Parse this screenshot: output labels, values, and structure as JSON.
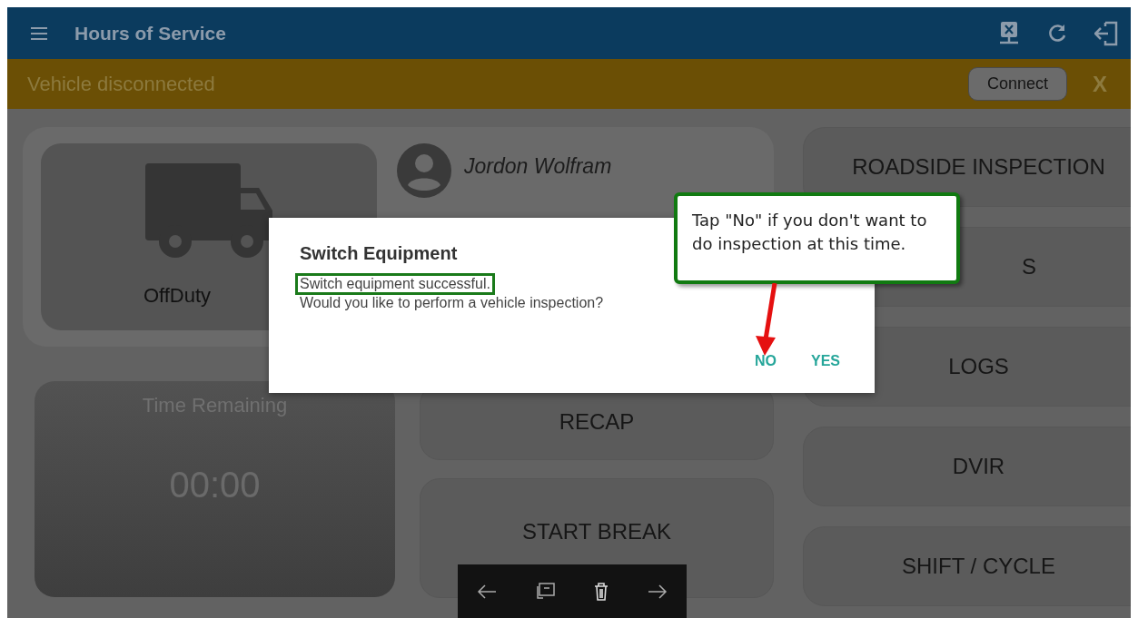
{
  "app_bar": {
    "title": "Hours of Service"
  },
  "banner": {
    "message": "Vehicle disconnected",
    "button": "Connect",
    "close": "X"
  },
  "status_card": {
    "duty_status": "OffDuty",
    "driver": "Jordon Wolfram"
  },
  "timer": {
    "label": "Time Remaining",
    "value": "00:00"
  },
  "middle_buttons": [
    "RECAP",
    "START BREAK"
  ],
  "right_buttons": [
    {
      "label": "ROADSIDE INSPECTION",
      "clipped": false
    },
    {
      "label": "S",
      "clipped": true
    },
    {
      "label": "LOGS",
      "clipped": false
    },
    {
      "label": "DVIR",
      "clipped": false
    },
    {
      "label": "SHIFT / CYCLE",
      "clipped": false
    }
  ],
  "dialog": {
    "title": "Switch Equipment",
    "lines": [
      {
        "text": "Switch equipment successful.",
        "highlighted": true
      },
      {
        "text": "Would you like to perform a vehicle inspection?",
        "highlighted": false
      }
    ],
    "actions": [
      "NO",
      "YES"
    ]
  },
  "callout": {
    "text": "Tap \"No\" if you don't want to do inspection at this time."
  }
}
